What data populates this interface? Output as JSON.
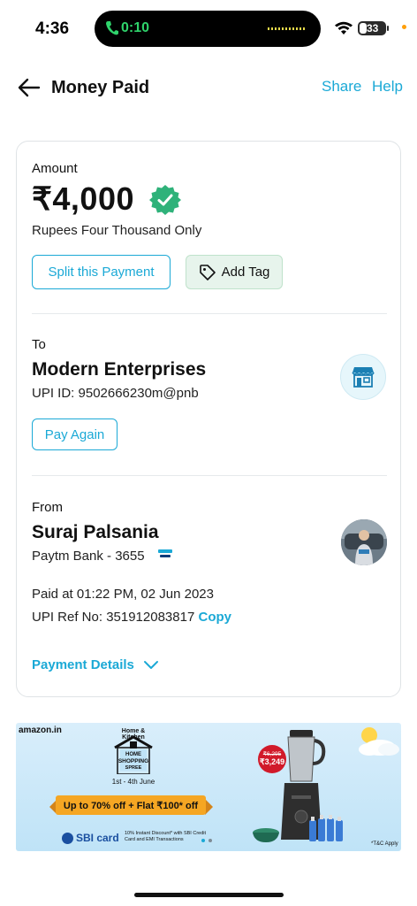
{
  "status_bar": {
    "time": "4:36",
    "call_timer": "0:10",
    "battery_level": "33"
  },
  "header": {
    "title": "Money Paid",
    "share_label": "Share",
    "help_label": "Help"
  },
  "amount_section": {
    "label": "Amount",
    "amount": "₹4,000",
    "amount_in_words": "Rupees Four Thousand Only",
    "split_button": "Split this Payment",
    "tag_button": "Add Tag"
  },
  "to_section": {
    "label": "To",
    "name": "Modern Enterprises",
    "upi_id": "UPI ID: 9502666230m@pnb",
    "pay_again_button": "Pay Again"
  },
  "from_section": {
    "label": "From",
    "name": "Suraj Palsania",
    "bank": "Paytm Bank - 3655",
    "paid_at": "Paid at 01:22 PM, 02 Jun 2023",
    "upi_ref": "UPI Ref No: 351912083817",
    "copy_label": "Copy"
  },
  "payment_details_label": "Payment Details",
  "ad_banner": {
    "brand": "amazon.in",
    "category": "Home & Kitchen",
    "event_line1": "HOME",
    "event_line2": "SHOPPING",
    "event_line3": "SPREE",
    "dates": "1st - 4th June",
    "offer": "Up to 70% off + Flat ₹100* off",
    "card_brand": "SBI card",
    "card_offer": "10% Instant Discount* with SBI Credit Card and EMI Transactions",
    "old_price": "₹6,295",
    "new_price": "₹3,249",
    "terms": "*T&C Apply"
  },
  "colors": {
    "accent": "#1ba9d6",
    "verified": "#2fb27a",
    "tag_bg": "#e7f4ec"
  }
}
